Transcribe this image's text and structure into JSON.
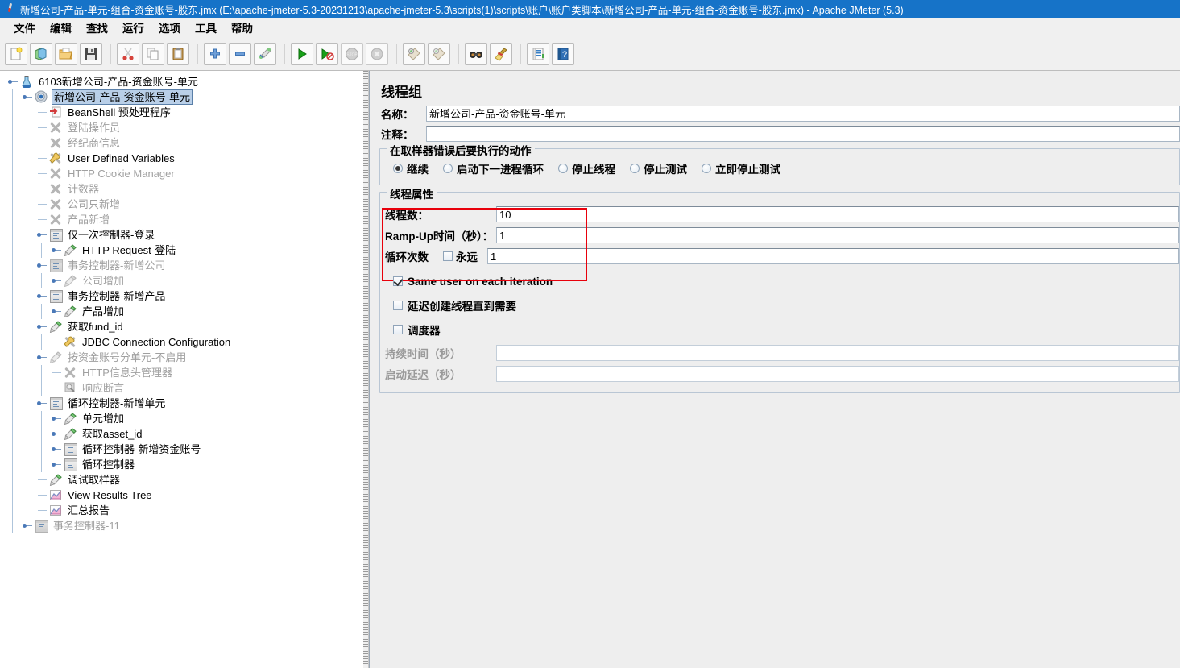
{
  "window": {
    "title": "新增公司-产品-单元-组合-资金账号-股东.jmx (E:\\apache-jmeter-5.3-20231213\\apache-jmeter-5.3\\scripts(1)\\scripts\\账户\\账户类脚本\\新增公司-产品-单元-组合-资金账号-股东.jmx) - Apache JMeter (5.3)",
    "app_icon": "jmeter-feather-icon"
  },
  "menubar": {
    "items": [
      {
        "label": "文件",
        "name": "menu-file"
      },
      {
        "label": "编辑",
        "name": "menu-edit"
      },
      {
        "label": "查找",
        "name": "menu-search"
      },
      {
        "label": "运行",
        "name": "menu-run"
      },
      {
        "label": "选项",
        "name": "menu-options"
      },
      {
        "label": "工具",
        "name": "menu-tools"
      },
      {
        "label": "帮助",
        "name": "menu-help"
      }
    ]
  },
  "toolbar": {
    "groups": [
      [
        {
          "icon": "new-document-icon",
          "name": "toolbar-new"
        },
        {
          "icon": "templates-icon",
          "name": "toolbar-templates"
        },
        {
          "icon": "open-folder-icon",
          "name": "toolbar-open"
        },
        {
          "icon": "save-floppy-icon",
          "name": "toolbar-save"
        }
      ],
      [
        {
          "icon": "cut-scissors-icon",
          "name": "toolbar-cut"
        },
        {
          "icon": "copy-icon",
          "name": "toolbar-copy"
        },
        {
          "icon": "paste-clipboard-icon",
          "name": "toolbar-paste"
        }
      ],
      [
        {
          "icon": "expand-plus-icon",
          "name": "toolbar-expand-all"
        },
        {
          "icon": "collapse-minus-icon",
          "name": "toolbar-collapse-all"
        },
        {
          "icon": "toggle-element-icon",
          "name": "toolbar-toggle"
        }
      ],
      [
        {
          "icon": "start-play-icon",
          "name": "toolbar-start"
        },
        {
          "icon": "start-no-pauses-icon",
          "name": "toolbar-start-no-pauses"
        },
        {
          "icon": "stop-icon",
          "name": "toolbar-stop",
          "disabled": true
        },
        {
          "icon": "shutdown-icon",
          "name": "toolbar-shutdown",
          "disabled": true
        }
      ],
      [
        {
          "icon": "clear-broom-icon",
          "name": "toolbar-clear"
        },
        {
          "icon": "clear-all-broom-icon",
          "name": "toolbar-clear-all"
        }
      ],
      [
        {
          "icon": "search-binoculars-icon",
          "name": "toolbar-search"
        },
        {
          "icon": "reset-search-broom-icon",
          "name": "toolbar-reset-search"
        }
      ],
      [
        {
          "icon": "function-helper-icon",
          "name": "toolbar-function-helper"
        },
        {
          "icon": "help-book-icon",
          "name": "toolbar-help"
        }
      ]
    ]
  },
  "tree": {
    "nodes": [
      {
        "label": "6103新增公司-产品-资金账号-单元",
        "depth": 0,
        "icon": "test-plan-icon",
        "toggle": "open",
        "state": "enabled",
        "selected": false
      },
      {
        "label": "新增公司-产品-资金账号-单元",
        "depth": 1,
        "icon": "thread-group-icon",
        "toggle": "open",
        "state": "enabled",
        "selected": true
      },
      {
        "label": "BeanShell 预处理程序",
        "depth": 2,
        "icon": "beanshell-preprocessor-icon",
        "toggle": "none",
        "state": "enabled",
        "selected": false
      },
      {
        "label": "登陆操作员",
        "depth": 2,
        "icon": "disabled-x-icon",
        "toggle": "none",
        "state": "disabled",
        "selected": false
      },
      {
        "label": "经纪商信息",
        "depth": 2,
        "icon": "disabled-x-icon",
        "toggle": "none",
        "state": "disabled",
        "selected": false
      },
      {
        "label": "User Defined Variables",
        "depth": 2,
        "icon": "udv-wrench-icon",
        "toggle": "none",
        "state": "enabled",
        "selected": false
      },
      {
        "label": "HTTP Cookie Manager",
        "depth": 2,
        "icon": "disabled-x-icon",
        "toggle": "none",
        "state": "disabled",
        "selected": false
      },
      {
        "label": "计数器",
        "depth": 2,
        "icon": "disabled-x-icon",
        "toggle": "none",
        "state": "disabled",
        "selected": false
      },
      {
        "label": "公司只新增",
        "depth": 2,
        "icon": "disabled-x-icon",
        "toggle": "none",
        "state": "disabled",
        "selected": false
      },
      {
        "label": "产品新增",
        "depth": 2,
        "icon": "disabled-x-icon",
        "toggle": "none",
        "state": "disabled",
        "selected": false
      },
      {
        "label": "仅一次控制器-登录",
        "depth": 2,
        "icon": "controller-icon",
        "toggle": "open",
        "state": "enabled",
        "selected": false
      },
      {
        "label": "HTTP Request-登陆",
        "depth": 3,
        "icon": "sampler-icon",
        "toggle": "open",
        "state": "enabled",
        "selected": false
      },
      {
        "label": "事务控制器-新增公司",
        "depth": 2,
        "icon": "controller-off-icon",
        "toggle": "open",
        "state": "disabled",
        "selected": false
      },
      {
        "label": "公司增加",
        "depth": 3,
        "icon": "sampler-off-icon",
        "toggle": "open",
        "state": "disabled",
        "selected": false
      },
      {
        "label": "事务控制器-新增产品",
        "depth": 2,
        "icon": "controller-icon",
        "toggle": "open",
        "state": "enabled",
        "selected": false
      },
      {
        "label": "产品增加",
        "depth": 3,
        "icon": "sampler-icon",
        "toggle": "open",
        "state": "enabled",
        "selected": false
      },
      {
        "label": "获取fund_id",
        "depth": 2,
        "icon": "sampler-icon",
        "toggle": "open",
        "state": "enabled",
        "selected": false
      },
      {
        "label": "JDBC Connection Configuration",
        "depth": 3,
        "icon": "jdbc-config-icon",
        "toggle": "none",
        "state": "enabled",
        "selected": false
      },
      {
        "label": "按资金账号分单元-不启用",
        "depth": 2,
        "icon": "sampler-off-icon",
        "toggle": "open",
        "state": "disabled",
        "selected": false
      },
      {
        "label": "HTTP信息头管理器",
        "depth": 3,
        "icon": "disabled-x-icon",
        "toggle": "none",
        "state": "disabled",
        "selected": false
      },
      {
        "label": "响应断言",
        "depth": 3,
        "icon": "assertion-off-icon",
        "toggle": "none",
        "state": "disabled",
        "selected": false
      },
      {
        "label": "循环控制器-新增单元",
        "depth": 2,
        "icon": "controller-icon",
        "toggle": "open",
        "state": "enabled",
        "selected": false
      },
      {
        "label": "单元增加",
        "depth": 3,
        "icon": "sampler-icon",
        "toggle": "open",
        "state": "enabled",
        "selected": false
      },
      {
        "label": "获取asset_id",
        "depth": 3,
        "icon": "sampler-icon",
        "toggle": "open",
        "state": "enabled",
        "selected": false
      },
      {
        "label": "循环控制器-新增资金账号",
        "depth": 3,
        "icon": "controller-icon",
        "toggle": "open",
        "state": "enabled",
        "selected": false
      },
      {
        "label": "循环控制器",
        "depth": 3,
        "icon": "controller-icon",
        "toggle": "open",
        "state": "enabled",
        "selected": false
      },
      {
        "label": "调试取样器",
        "depth": 2,
        "icon": "sampler-icon",
        "toggle": "none",
        "state": "enabled",
        "selected": false
      },
      {
        "label": "View Results Tree",
        "depth": 2,
        "icon": "listener-chart-icon",
        "toggle": "none",
        "state": "enabled",
        "selected": false
      },
      {
        "label": "汇总报告",
        "depth": 2,
        "icon": "listener-chart-icon",
        "toggle": "none",
        "state": "enabled",
        "selected": false
      },
      {
        "label": "事务控制器-11",
        "depth": 1,
        "icon": "controller-off-icon",
        "toggle": "open",
        "state": "disabled",
        "selected": false
      }
    ]
  },
  "panel": {
    "heading": "线程组",
    "name_label": "名称：",
    "name_value": "新增公司-产品-资金账号-单元",
    "comment_label": "注释：",
    "comment_value": "",
    "comment_placeholder": "",
    "on_error": {
      "title": "在取样器错误后要执行的动作",
      "options": [
        {
          "label": "继续",
          "selected": true
        },
        {
          "label": "启动下一进程循环",
          "selected": false
        },
        {
          "label": "停止线程",
          "selected": false
        },
        {
          "label": "停止测试",
          "selected": false
        },
        {
          "label": "立即停止测试",
          "selected": false
        }
      ]
    },
    "thread_properties": {
      "title": "线程属性",
      "threads_label": "线程数：",
      "threads_value": "10",
      "rampup_label": "Ramp-Up时间（秒）：",
      "rampup_value": "1",
      "loops_label": "循环次数",
      "loops_forever_label": "永远",
      "loops_forever_checked": false,
      "loops_value": "1",
      "same_user_label": "Same user on each iteration",
      "same_user_checked": true,
      "delay_create_label": "延迟创建线程直到需要",
      "delay_create_checked": false,
      "scheduler_label": "调度器",
      "scheduler_checked": false,
      "duration_label": "持续时间（秒）",
      "duration_value": "",
      "startup_delay_label": "启动延迟（秒）",
      "startup_delay_value": ""
    },
    "highlight_color": "#e8000b"
  },
  "colors": {
    "titlebar": "#1673c8",
    "panel_bg": "#eeeeee",
    "accent": "#4a79b8",
    "highlight": "#e8000b",
    "selection": "#b9cfe8"
  }
}
